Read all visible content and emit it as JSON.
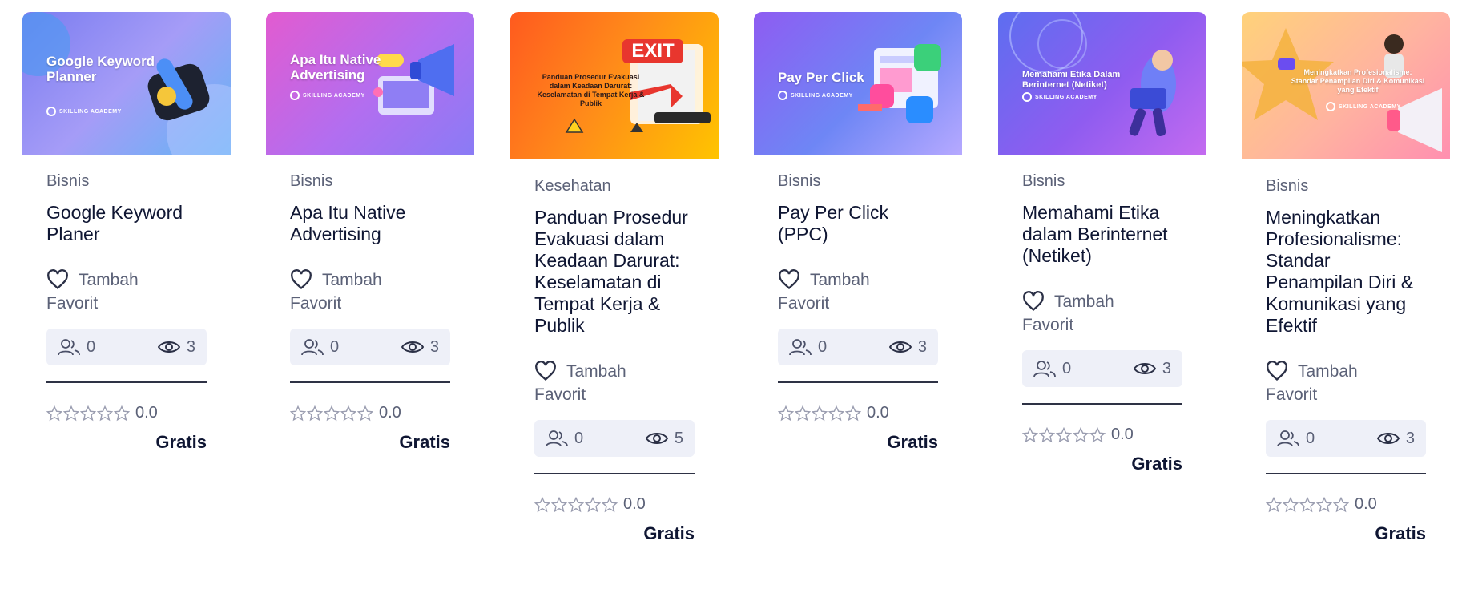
{
  "brand_colors": {
    "title": "#0f1633",
    "muted": "#5b6177",
    "stats_bg": "#eef0f8"
  },
  "courses": [
    {
      "thumb_title": "Google Keyword Planner",
      "thumb_logo": "SKILLING ACADEMY",
      "category": "Bisnis",
      "title": "Google Keyword Planer",
      "fav_line1": "Tambah",
      "fav_line2": "Favorit",
      "participants": "0",
      "views": "3",
      "rating": "0.0",
      "price": "Gratis"
    },
    {
      "thumb_title": "Apa Itu Native Advertising",
      "thumb_logo": "SKILLING ACADEMY",
      "category": "Bisnis",
      "title": "Apa Itu Native Advertising",
      "fav_line1": "Tambah",
      "fav_line2": "Favorit",
      "participants": "0",
      "views": "3",
      "rating": "0.0",
      "price": "Gratis"
    },
    {
      "thumb_title": "Panduan Prosedur Evakuasi dalam Keadaan Darurat: Keselamatan di Tempat Kerja & Publik",
      "thumb_badge": "EXIT",
      "category": "Kesehatan",
      "title": "Panduan Prosedur Evakuasi dalam Keadaan Darurat: Keselamatan di Tempat Kerja & Publik",
      "fav_line1": "Tambah",
      "fav_line2": "Favorit",
      "participants": "0",
      "views": "5",
      "rating": "0.0",
      "price": "Gratis"
    },
    {
      "thumb_title": "Pay Per Click",
      "thumb_logo": "SKILLING ACADEMY",
      "category": "Bisnis",
      "title": "Pay Per Click (PPC)",
      "fav_line1": "Tambah",
      "fav_line2": "Favorit",
      "participants": "0",
      "views": "3",
      "rating": "0.0",
      "price": "Gratis"
    },
    {
      "thumb_title": "Memahami Etika Dalam Berinternet (Netiket)",
      "thumb_logo": "SKILLING ACADEMY",
      "category": "Bisnis",
      "title": "Memahami Etika dalam Berinternet (Netiket)",
      "fav_line1": "Tambah",
      "fav_line2": "Favorit",
      "participants": "0",
      "views": "3",
      "rating": "0.0",
      "price": "Gratis"
    },
    {
      "thumb_title": "Meningkatkan Profesionalisme: Standar Penampilan Diri & Komunikasi yang Efektif",
      "thumb_logo": "SKILLING ACADEMY",
      "category": "Bisnis",
      "title": "Meningkatkan Profesionalisme: Standar Penampilan Diri & Komunikasi yang Efektif",
      "fav_line1": "Tambah",
      "fav_line2": "Favorit",
      "participants": "0",
      "views": "3",
      "rating": "0.0",
      "price": "Gratis"
    }
  ]
}
